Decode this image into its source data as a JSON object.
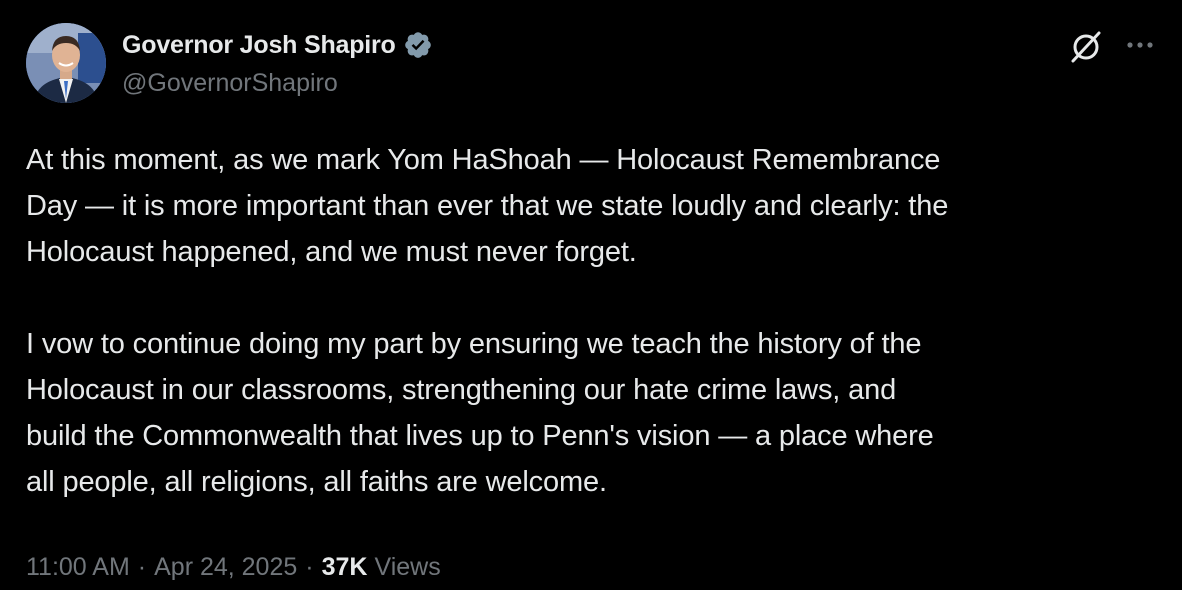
{
  "author": {
    "display_name": "Governor Josh Shapiro",
    "handle": "@GovernorShapiro",
    "verified_icon": "verified-badge-icon",
    "verified_color": "#829aab"
  },
  "actions": {
    "grok_icon": "grok-icon",
    "more_icon": "more-options-icon"
  },
  "tweet": {
    "paragraph1": [
      "At this moment, as we mark Yom HaShoah — Holocaust Remembrance",
      "Day — it is more important than ever that we state loudly and clearly: the",
      "Holocaust happened, and we must never forget."
    ],
    "paragraph2": [
      "I vow to continue doing my part by ensuring we teach the history of the",
      "Holocaust in our classrooms, strengthening our hate crime laws, and",
      "build the Commonwealth that lives up to Penn's vision — a place where",
      "all people, all religions, all faiths are welcome."
    ]
  },
  "meta": {
    "time": "11:00 AM",
    "separator": "·",
    "date": "Apr 24, 2025",
    "views_count": "37K",
    "views_label": "Views"
  },
  "colors": {
    "background": "#000000",
    "primary_text": "#e7e9ea",
    "secondary_text": "#71767b"
  }
}
